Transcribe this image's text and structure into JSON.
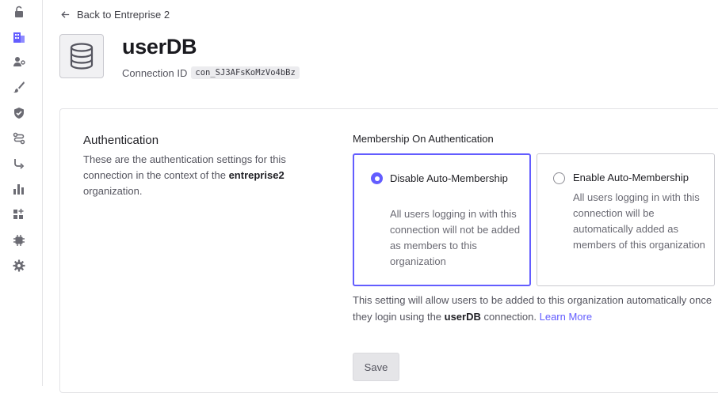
{
  "nav": {
    "back_label": "Back to Entreprise 2",
    "items": [
      {
        "icon": "lock-open-icon"
      },
      {
        "icon": "organizations-icon",
        "active": true
      },
      {
        "icon": "user-settings-icon"
      },
      {
        "icon": "brush-icon"
      },
      {
        "icon": "shield-check-icon"
      },
      {
        "icon": "flow-icon"
      },
      {
        "icon": "connection-icon"
      },
      {
        "icon": "bar-chart-icon"
      },
      {
        "icon": "extensions-icon"
      },
      {
        "icon": "chip-icon"
      },
      {
        "icon": "settings-gear-icon"
      }
    ]
  },
  "header": {
    "title": "userDB",
    "connection_id_label": "Connection ID",
    "connection_id": "con_SJ3AFsKoMzVo4bBz"
  },
  "section": {
    "title": "Authentication",
    "desc_before": "These are the authentication settings for this connection in the context of the ",
    "desc_org": "entreprise2",
    "desc_after": " organization."
  },
  "membership": {
    "label": "Membership On Authentication",
    "options": [
      {
        "title": "Disable Auto-Membership",
        "desc": "All users logging in with this connection will not be added as members to this organization",
        "selected": true
      },
      {
        "title": "Enable Auto-Membership",
        "desc": "All users logging in with this connection will be automatically added as members of this organization",
        "selected": false
      }
    ],
    "help_before": "This setting will allow users to be added to this organization automatically once they login using the ",
    "help_conn": "userDB",
    "help_after": " connection. ",
    "learn_more": "Learn More"
  },
  "save_label": "Save",
  "colors": {
    "accent": "#635dff",
    "text": "#1f1f24",
    "muted": "#55555f",
    "border": "#c9c9cf"
  }
}
